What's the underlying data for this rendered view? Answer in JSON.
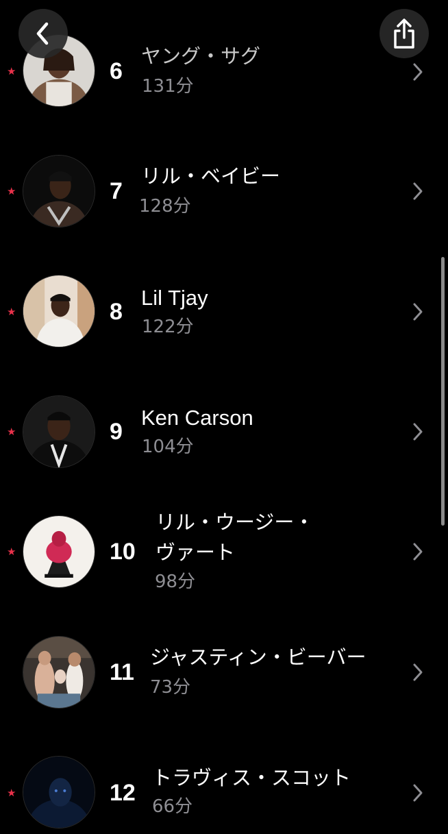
{
  "colors": {
    "background": "#000000",
    "star": "#e8314a",
    "secondary_text": "#8e8e93",
    "chevron": "#8e8e93"
  },
  "icons": {
    "back": "chevron-left-icon",
    "share": "share-icon",
    "favorite": "star-icon",
    "row_chevron": "chevron-right-icon"
  },
  "artists": [
    {
      "rank": "6",
      "name": "ヤング・サグ",
      "minutes": "131分",
      "favorite": true
    },
    {
      "rank": "7",
      "name": "リル・ベイビー",
      "minutes": "128分",
      "favorite": true
    },
    {
      "rank": "8",
      "name": "Lil Tjay",
      "minutes": "122分",
      "favorite": true
    },
    {
      "rank": "9",
      "name": "Ken Carson",
      "minutes": "104分",
      "favorite": true
    },
    {
      "rank": "10",
      "name_line1": "リル・ウージー・",
      "name_line2": "ヴァート",
      "minutes": "98分",
      "favorite": true
    },
    {
      "rank": "11",
      "name": "ジャスティン・ビーバー",
      "minutes": "73分",
      "favorite": false
    },
    {
      "rank": "12",
      "name": "トラヴィス・スコット",
      "minutes": "66分",
      "favorite": true
    }
  ],
  "star_glyph": "★"
}
